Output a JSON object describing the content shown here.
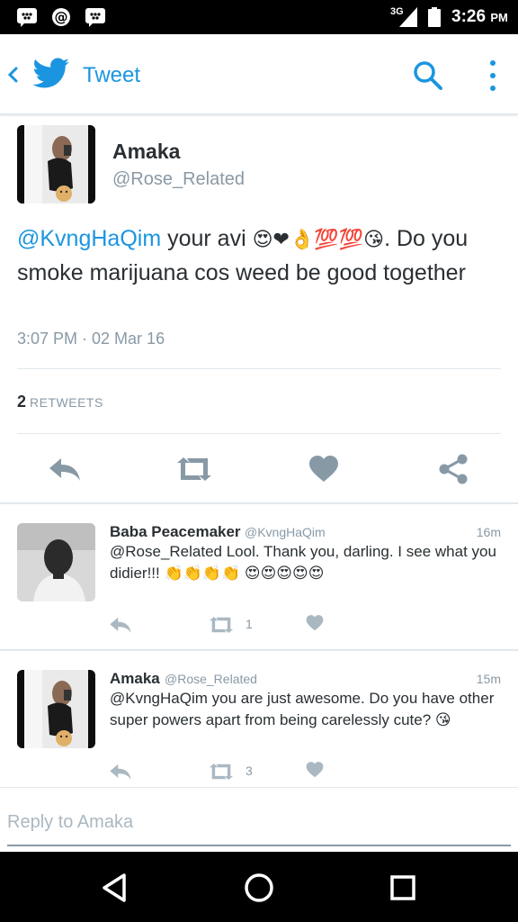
{
  "status_bar": {
    "network": "3G",
    "time": "3:26",
    "ampm": "PM",
    "icons": [
      "bbm-icon",
      "at-icon",
      "bbm-icon",
      "signal-icon",
      "battery-icon"
    ]
  },
  "app_bar": {
    "title": "Tweet",
    "accent": "#1b95e0"
  },
  "tweet": {
    "name": "Amaka",
    "handle": "@Rose_Related",
    "mention": "@KvngHaQim",
    "text_a": " your avi ",
    "emojis": "😍❤👌💯💯😘",
    "text_b": ". Do you smoke marijuana cos weed be good together",
    "timestamp": "3:07 PM · 02 Mar 16",
    "retweet_count": "2",
    "retweet_label": "RETWEETS"
  },
  "replies": [
    {
      "name": "Baba Peacemaker",
      "handle": "@KvngHaQim",
      "time": "16m",
      "text": "@Rose_Related Lool. Thank you, darling. I see what you didier!!! 👏👏👏👏 😍😍😍😍😍",
      "retweets": "1"
    },
    {
      "name": "Amaka",
      "handle": "@Rose_Related",
      "time": "15m",
      "text": "@KvngHaQim you are just awesome. Do you have other super powers apart from being carelessly cute? 😘",
      "retweets": "3"
    }
  ],
  "reply_box": {
    "placeholder": "Reply to Amaka"
  }
}
